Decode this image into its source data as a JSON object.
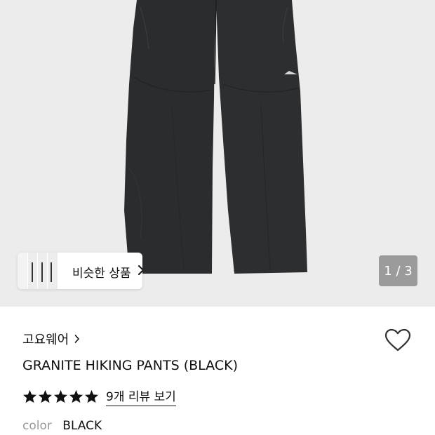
{
  "hero": {
    "similar_label": "비슷한 상품",
    "counter": "1 / 3"
  },
  "product": {
    "brand": "고요웨어",
    "title": "GRANITE HIKING PANTS (BLACK)",
    "rating": 5,
    "reviews_link": "9개 리뷰 보기",
    "color_label": "color",
    "color_value": "BLACK"
  },
  "icons": {
    "brand_chevron": "chevron-right-icon",
    "similar_chevron": "chevron-right-icon",
    "wishlist": "heart-outline-icon",
    "star": "star-filled-icon"
  },
  "colors": {
    "hero_bg": "#ececec",
    "pants": "#2a2b2d",
    "counter_bg": "#9b9b9b"
  }
}
